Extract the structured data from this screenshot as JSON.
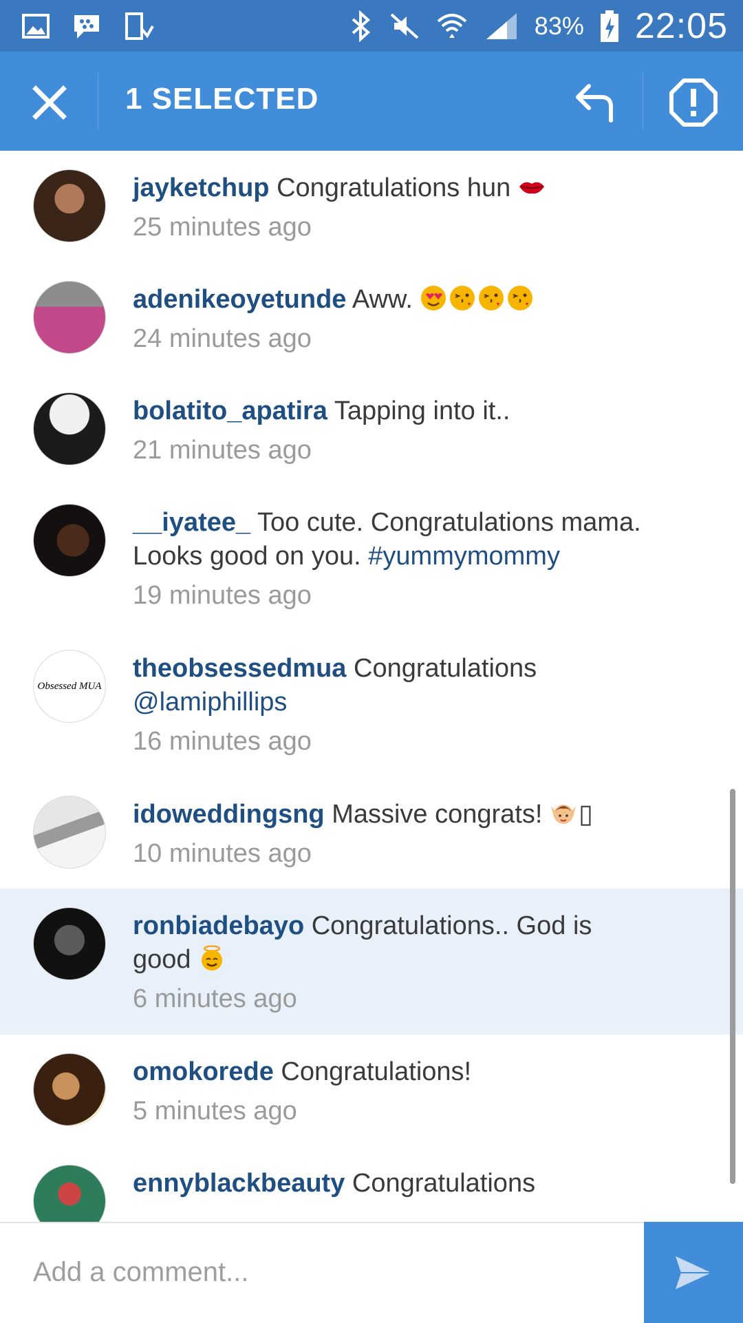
{
  "status_bar": {
    "battery_percent": "83%",
    "time": "22:05",
    "icons": [
      "gallery-icon",
      "bbm-icon",
      "device-download-icon",
      "bluetooth-icon",
      "mute-icon",
      "wifi-icon",
      "signal-icon",
      "battery-charging-icon"
    ]
  },
  "action_bar": {
    "title": "1 SELECTED",
    "icons": [
      "close-icon",
      "reply-icon",
      "report-icon"
    ],
    "background": "#418dd9"
  },
  "comments": [
    {
      "username": "jayketchup",
      "text": "Congratulations hun",
      "emoji": [
        "lips"
      ],
      "time": "25 minutes ago",
      "selected": false
    },
    {
      "username": "adenikeoyetunde",
      "text": "Aww.",
      "emoji": [
        "heart-eyes",
        "kiss",
        "kiss",
        "kiss"
      ],
      "time": "24 minutes ago",
      "selected": false
    },
    {
      "username": "bolatito_apatira",
      "text": "Tapping into it..",
      "emoji": [],
      "time": "21 minutes ago",
      "selected": false
    },
    {
      "username": "__iyatee_",
      "text": "Too cute.  Congratulations mama. Looks good on you.",
      "hashtag": "#yummymommy",
      "time": "19 minutes ago",
      "selected": false
    },
    {
      "username": "theobsessedmua",
      "text": "Congratulations",
      "mention": "@lamiphillips",
      "avatar_text": "Obsessed MUA",
      "time": "16 minutes ago",
      "selected": false
    },
    {
      "username": "idoweddingsng",
      "text": "Massive congrats!",
      "emoji": [
        "raised-hands"
      ],
      "trailing_glyph": "▯",
      "time": "10 minutes ago",
      "selected": false
    },
    {
      "username": "ronbiadebayo",
      "text": "Congratulations.. God is good",
      "emoji": [
        "angel"
      ],
      "time": "6 minutes ago",
      "selected": true
    },
    {
      "username": "omokorede",
      "text": "Congratulations!",
      "emoji": [],
      "time": "5 minutes ago",
      "selected": false
    },
    {
      "username": "ennyblackbeauty",
      "text": "Congratulations",
      "emoji": [],
      "time": "",
      "selected": false
    }
  ],
  "composer": {
    "placeholder": "Add a comment...",
    "send_icon": "send-icon"
  },
  "colors": {
    "status_bar": "#3a79c0",
    "accent": "#418dd9",
    "username": "#1f4f82",
    "selected_row": "#e8f0f9",
    "timestamp": "#9a9a9a"
  }
}
